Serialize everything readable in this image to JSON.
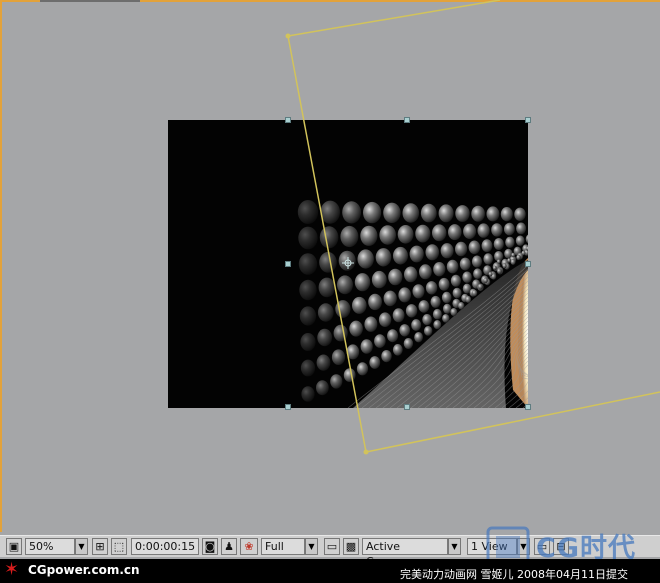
{
  "footer": {
    "site": "CGpower.com.cn",
    "credit": "完美动力动画网 雪姬儿 2008年04月11日提交"
  },
  "toolbar": {
    "zoom": "50%",
    "timecode": "0:00:00:15",
    "resolution": "Full",
    "camera": "Active Camera",
    "views": "1 View"
  },
  "watermark": {
    "text": "CG时代"
  },
  "icons": {
    "footer_logo": "red-star-icon"
  },
  "colors": {
    "canvas_bg": "#a5a6a8",
    "active_border": "#e3a23a",
    "camera_box": "#d2c35b",
    "handles": "#a9cfd0"
  }
}
